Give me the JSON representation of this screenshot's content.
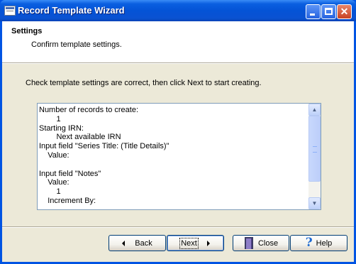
{
  "window": {
    "title": "Record Template Wizard"
  },
  "header": {
    "title": "Settings",
    "subtitle": "Confirm template settings."
  },
  "instructions": "Check template settings are correct, then click Next to start creating.",
  "settings_lines": [
    "Number of records to create:",
    "        1",
    "Starting IRN:",
    "        Next available IRN",
    "Input field \"Series Title: (Title Details)\"",
    "    Value:",
    "",
    "Input field \"Notes\"",
    "    Value:",
    "        1",
    "    Increment By:"
  ],
  "buttons": {
    "back": "Back",
    "next": "Next",
    "close": "Close",
    "help": "Help"
  }
}
